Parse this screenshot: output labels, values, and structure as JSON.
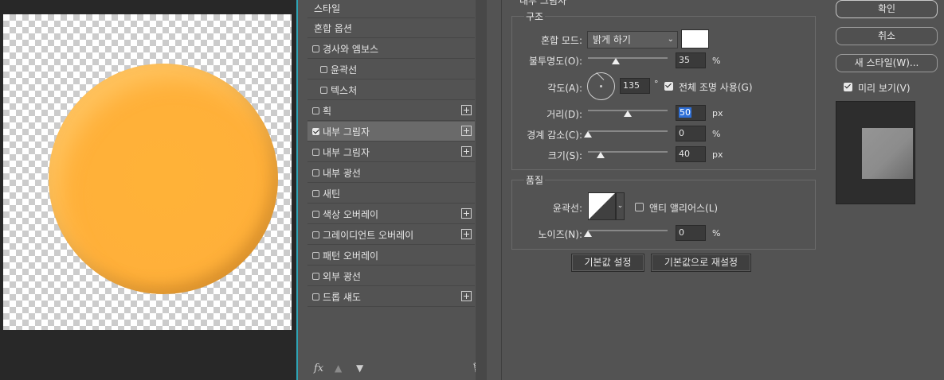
{
  "styles_list": {
    "header": "스타일",
    "blend_options": "혼합 옵션",
    "items": [
      {
        "label": "경사와 엠보스",
        "checked": false,
        "indent": false,
        "plus": false
      },
      {
        "label": "윤곽선",
        "checked": false,
        "indent": true,
        "plus": false
      },
      {
        "label": "텍스처",
        "checked": false,
        "indent": true,
        "plus": false
      },
      {
        "label": "획",
        "checked": false,
        "indent": false,
        "plus": true
      },
      {
        "label": "내부 그림자",
        "checked": true,
        "indent": false,
        "plus": true
      },
      {
        "label": "내부 그림자",
        "checked": false,
        "indent": false,
        "plus": true
      },
      {
        "label": "내부 광선",
        "checked": false,
        "indent": false,
        "plus": false
      },
      {
        "label": "새틴",
        "checked": false,
        "indent": false,
        "plus": false
      },
      {
        "label": "색상 오버레이",
        "checked": false,
        "indent": false,
        "plus": true
      },
      {
        "label": "그레이디언트 오버레이",
        "checked": false,
        "indent": false,
        "plus": true
      },
      {
        "label": "패턴 오버레이",
        "checked": false,
        "indent": false,
        "plus": false
      },
      {
        "label": "외부 광선",
        "checked": false,
        "indent": false,
        "plus": false
      },
      {
        "label": "드롭 섀도",
        "checked": false,
        "indent": false,
        "plus": true
      }
    ],
    "fx_label": "fx"
  },
  "settings": {
    "panel_title": "내부 그림자",
    "structure_title": "구조",
    "blend_mode_label": "혼합 모드:",
    "blend_mode_value": "밝게 하기",
    "opacity_label": "불투명도(O):",
    "opacity_value": "35",
    "angle_label": "각도(A):",
    "angle_value": "135",
    "degree_symbol": "°",
    "global_light_label": "전체 조명 사용(G)",
    "global_light_checked": true,
    "distance_label": "거리(D):",
    "distance_value": "50",
    "choke_label": "경계 감소(C):",
    "choke_value": "0",
    "size_label": "크기(S):",
    "size_value": "40",
    "unit_percent": "%",
    "unit_px": "px",
    "quality_title": "품질",
    "contour_label": "윤곽선:",
    "antialias_label": "앤티 앨리어스(L)",
    "antialias_checked": false,
    "noise_label": "노이즈(N):",
    "noise_value": "0",
    "default_button": "기본값 설정",
    "reset_button": "기본값으로 재설정",
    "shadow_color": "#ffffff"
  },
  "sliders": {
    "opacity": 0.35,
    "distance": 0.5,
    "choke": 0,
    "size": 0.16,
    "noise": 0
  },
  "right_panel": {
    "ok_button": "확인",
    "cancel_button": "취소",
    "new_style_button": "새 스타일(W)...",
    "preview_label": "미리 보기(V)",
    "preview_checked": true
  },
  "canvas": {
    "circle_color": "#ffb038"
  }
}
